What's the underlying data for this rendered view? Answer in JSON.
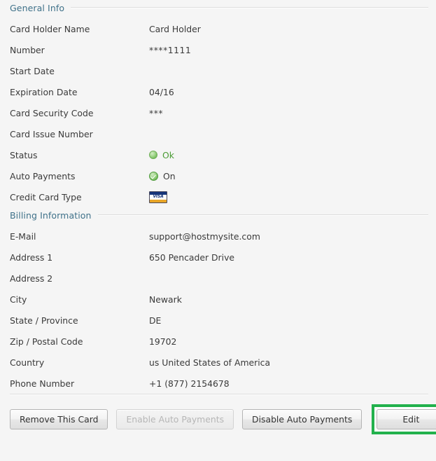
{
  "sections": [
    {
      "title": "General Info",
      "fields": [
        {
          "label": "Card Holder Name",
          "value": "Card Holder",
          "type": "text"
        },
        {
          "label": "Number",
          "value": "****1111",
          "type": "text"
        },
        {
          "label": "Start Date",
          "value": "",
          "type": "text"
        },
        {
          "label": "Expiration Date",
          "value": "04/16",
          "type": "text"
        },
        {
          "label": "Card Security Code",
          "value": "***",
          "type": "text"
        },
        {
          "label": "Card Issue Number",
          "value": "",
          "type": "text"
        },
        {
          "label": "Status",
          "value": "Ok",
          "type": "status-dot",
          "icon": "green-circle-icon"
        },
        {
          "label": "Auto Payments",
          "value": "On",
          "type": "status-check",
          "icon": "green-check-icon"
        },
        {
          "label": "Credit Card Type",
          "value": "VISA",
          "type": "card-brand",
          "icon": "visa-card-icon"
        }
      ]
    },
    {
      "title": "Billing Information",
      "fields": [
        {
          "label": "E-Mail",
          "value": "support@hostmysite.com",
          "type": "text"
        },
        {
          "label": "Address 1",
          "value": "650 Pencader Drive",
          "type": "text"
        },
        {
          "label": "Address 2",
          "value": "",
          "type": "text"
        },
        {
          "label": "City",
          "value": "Newark",
          "type": "text"
        },
        {
          "label": "State / Province",
          "value": "DE",
          "type": "text"
        },
        {
          "label": "Zip / Postal Code",
          "value": "19702",
          "type": "text"
        },
        {
          "label": "Country",
          "value": "us United States of America",
          "type": "text"
        },
        {
          "label": "Phone Number",
          "value": "+1 (877) 2154678",
          "type": "text"
        }
      ]
    }
  ],
  "buttons": {
    "remove_card": "Remove This Card",
    "enable_auto_payments": "Enable Auto Payments",
    "disable_auto_payments": "Disable Auto Payments",
    "edit": "Edit"
  },
  "colors": {
    "section_title": "#3f7189",
    "label_text": "#3a3a3a",
    "status_ok_text": "#4a9b34",
    "highlight_border": "#22b14c",
    "page_background": "#f5f5f5"
  }
}
